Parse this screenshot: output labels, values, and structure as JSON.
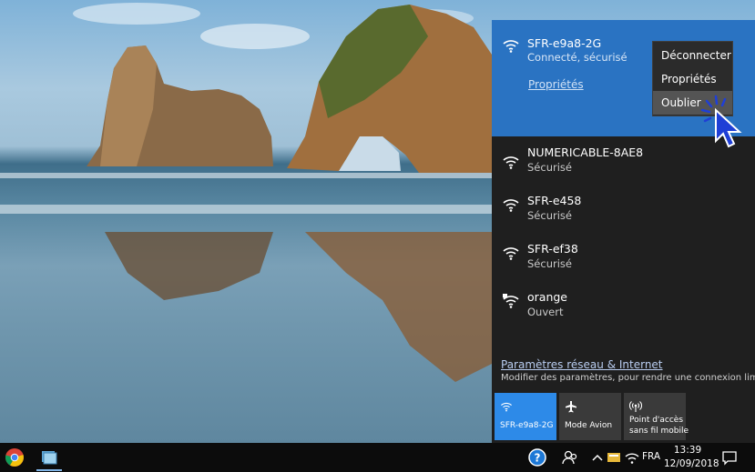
{
  "networks": {
    "connected": {
      "name": "SFR-e9a8-2G",
      "status": "Connecté, sécurisé",
      "properties_link": "Propriétés"
    },
    "context_menu": {
      "items": [
        "Déconnecter",
        "Propriétés",
        "Oublier"
      ],
      "highlighted": "Oublier"
    },
    "available": [
      {
        "name": "NUMERICABLE-8AE8",
        "status": "Sécurisé",
        "icon": "wifi-icon"
      },
      {
        "name": "SFR-e458",
        "status": "Sécurisé",
        "icon": "wifi-icon"
      },
      {
        "name": "SFR-ef38",
        "status": "Sécurisé",
        "icon": "wifi-icon"
      },
      {
        "name": "orange",
        "status": "Ouvert",
        "icon": "wifi-open-shield-icon"
      }
    ]
  },
  "settings": {
    "link": "Paramètres réseau & Internet",
    "description": "Modifier des paramètres, pour rendre une connexion limitée."
  },
  "quick_actions": [
    {
      "label": "SFR-e9a8-2G",
      "icon": "wifi-icon",
      "active": true
    },
    {
      "label": "Mode Avion",
      "icon": "airplane-icon",
      "active": false
    },
    {
      "label_line1": "Point d'accès",
      "label_line2": "sans fil mobile",
      "icon": "hotspot-icon",
      "active": false
    }
  ],
  "taskbar": {
    "language": "FRA",
    "time": "13:39",
    "date": "12/09/2018"
  },
  "colors": {
    "accent": "#2a73c2",
    "tile_active": "#2d8ae8",
    "flyout_bg": "#1f1f1f",
    "taskbar_bg": "#0c0c0c"
  }
}
